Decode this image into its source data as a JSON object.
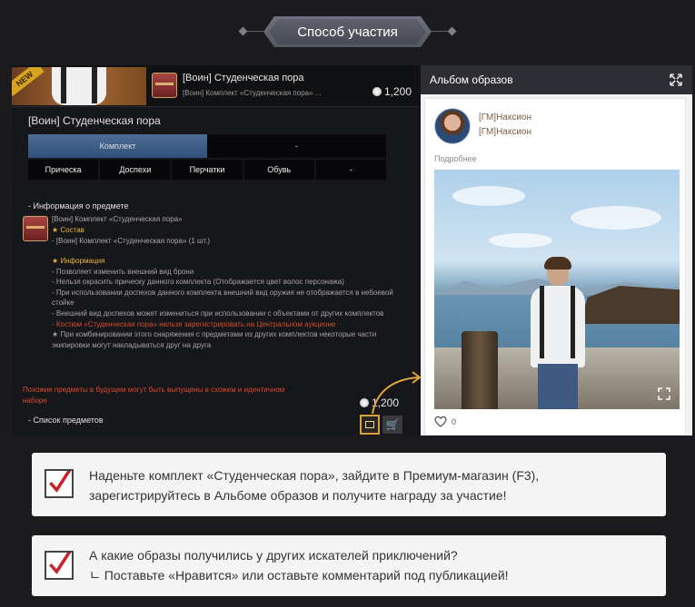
{
  "banner": {
    "title": "Способ участия"
  },
  "item_panel": {
    "new_badge": "NEW",
    "top_name": "[Воин] Студенческая пора",
    "top_sub": "[Воин] Комплект «Студенческая пора» ...",
    "top_price": "1,200",
    "title": "[Воин] Студенческая пора",
    "tabs": [
      {
        "label": "Комплект",
        "active": true
      },
      {
        "label": "-",
        "active": false
      }
    ],
    "parts": [
      "Прическа",
      "Доспехи",
      "Перчатки",
      "Обувь",
      "-"
    ],
    "info_header": "- Информация о предмете",
    "info_lines": [
      "[Воин] Комплект «Студенческая пора»",
      "★ Состав",
      "- [Воин] Комплект «Студенческая пора» (1 шт.)"
    ],
    "desc_header": "★ Информация",
    "desc_lines": [
      "- Позволяет изменить внешний вид брони",
      "- Нельзя окрасить прическу данного комплекта  (Отображается цвет волос персонажа)",
      "- При использовании доспехов данного комплекта внешний вид оружия не отображается в небоевой стойке",
      "- Внешний вид доспехов может измениться при использовании с объектами от других комплектов",
      "- Костюм «Студенческая пора» нельзя зарегистрировать на Центральном аукционе",
      "★ При комбинировании этого снаряжения с предметами из других комплектов некоторые части экипировки могут накладываться друг на друга"
    ],
    "future_note": "Похожие предметы в будущем могут быть выпущены в схожем и идентичном наборе",
    "bottom_price": "1,200",
    "list_header": "- Список предметов"
  },
  "album": {
    "title": "Альбом образов",
    "author_1": "[ГМ]Наксион",
    "author_2": "[ГМ]Наксион",
    "more": "Подробнее",
    "likes": "0"
  },
  "instructions": [
    {
      "lines": [
        "Наденьте комплект «Студенческая пора», зайдите в Премиум-магазин (F3),",
        "зарегистрируйтесь в Альбоме образов и получите награду за участие!"
      ]
    },
    {
      "lines": [
        "А какие образы получились у других искателей приключений?",
        "ㄴ Поставьте «Нравится» или оставьте комментарий под публикацией!"
      ]
    }
  ],
  "colors": {
    "accent_gold": "#e7b53c",
    "warning_red": "#d94a2e",
    "check_red": "#c8202a",
    "tab_active": "#3d5d88"
  }
}
